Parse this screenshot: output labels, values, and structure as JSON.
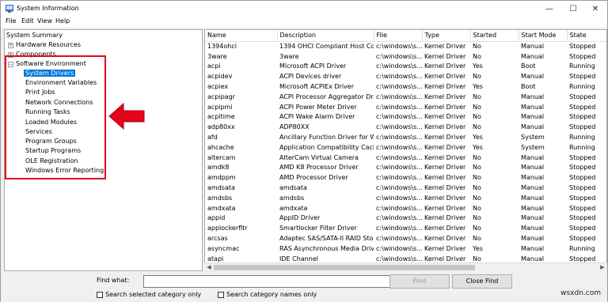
{
  "window": {
    "title": "System Information",
    "icon": "system-info-icon",
    "controls": {
      "minimize": "—",
      "maximize": "☐",
      "close": "✕"
    }
  },
  "menu": [
    "File",
    "Edit",
    "View",
    "Help"
  ],
  "tree": {
    "system_summary": "System Summary",
    "hardware_resources": "Hardware Resources",
    "components": "Components",
    "software_environment": "Software Environment",
    "children": [
      "System Drivers",
      "Environment Variables",
      "Print Jobs",
      "Network Connections",
      "Running Tasks",
      "Loaded Modules",
      "Services",
      "Program Groups",
      "Startup Programs",
      "OLE Registration",
      "Windows Error Reporting"
    ],
    "selected": "System Drivers",
    "expander_plus": "+",
    "expander_minus": "−"
  },
  "annotation": {
    "box_color": "#e3051a",
    "arrow_color": "#e3051a"
  },
  "table": {
    "columns": [
      "Name",
      "Description",
      "File",
      "Type",
      "Started",
      "Start Mode",
      "State"
    ],
    "rows": [
      [
        "1394ohci",
        "1394 OHCI Compliant Host Co...",
        "c:\\windows\\s...",
        "Kernel Driver",
        "No",
        "Manual",
        "Stopped"
      ],
      [
        "3ware",
        "3ware",
        "c:\\windows\\s...",
        "Kernel Driver",
        "No",
        "Manual",
        "Stopped"
      ],
      [
        "acpi",
        "Microsoft ACPI Driver",
        "c:\\windows\\s...",
        "Kernel Driver",
        "Yes",
        "Boot",
        "Running"
      ],
      [
        "acpidev",
        "ACPI Devices driver",
        "c:\\windows\\s...",
        "Kernel Driver",
        "No",
        "Manual",
        "Stopped"
      ],
      [
        "acpiex",
        "Microsoft ACPIEx Driver",
        "c:\\windows\\s...",
        "Kernel Driver",
        "Yes",
        "Boot",
        "Running"
      ],
      [
        "acpipagr",
        "ACPI Processor Aggregator Dr...",
        "c:\\windows\\s...",
        "Kernel Driver",
        "No",
        "Manual",
        "Stopped"
      ],
      [
        "acpipmi",
        "ACPI Power Meter Driver",
        "c:\\windows\\s...",
        "Kernel Driver",
        "No",
        "Manual",
        "Stopped"
      ],
      [
        "acpitime",
        "ACPI Wake Alarm Driver",
        "c:\\windows\\s...",
        "Kernel Driver",
        "No",
        "Manual",
        "Stopped"
      ],
      [
        "adp80xx",
        "ADP80XX",
        "c:\\windows\\s...",
        "Kernel Driver",
        "No",
        "Manual",
        "Stopped"
      ],
      [
        "afd",
        "Ancillary Function Driver for Wi...",
        "c:\\windows\\s...",
        "Kernel Driver",
        "Yes",
        "System",
        "Running"
      ],
      [
        "ahcache",
        "Application Compatibility Cache",
        "c:\\windows\\s...",
        "Kernel Driver",
        "Yes",
        "System",
        "Running"
      ],
      [
        "altercam",
        "AlterCam Virtual Camera",
        "c:\\windows\\s...",
        "Kernel Driver",
        "No",
        "Manual",
        "Stopped"
      ],
      [
        "amdk8",
        "AMD K8 Processor Driver",
        "c:\\windows\\s...",
        "Kernel Driver",
        "No",
        "Manual",
        "Stopped"
      ],
      [
        "amdppm",
        "AMD Processor Driver",
        "c:\\windows\\s...",
        "Kernel Driver",
        "No",
        "Manual",
        "Stopped"
      ],
      [
        "amdsata",
        "amdsata",
        "c:\\windows\\s...",
        "Kernel Driver",
        "No",
        "Manual",
        "Stopped"
      ],
      [
        "amdsbs",
        "amdsbs",
        "c:\\windows\\s...",
        "Kernel Driver",
        "No",
        "Manual",
        "Stopped"
      ],
      [
        "amdxata",
        "amdxata",
        "c:\\windows\\s...",
        "Kernel Driver",
        "No",
        "Manual",
        "Stopped"
      ],
      [
        "appid",
        "AppID Driver",
        "c:\\windows\\s...",
        "Kernel Driver",
        "No",
        "Manual",
        "Stopped"
      ],
      [
        "applockerfltr",
        "Smartlocker Filter Driver",
        "c:\\windows\\s...",
        "Kernel Driver",
        "No",
        "Manual",
        "Stopped"
      ],
      [
        "arcsas",
        "Adaptec SAS/SATA-II RAID Stor...",
        "c:\\windows\\s...",
        "Kernel Driver",
        "No",
        "Manual",
        "Stopped"
      ],
      [
        "asyncmac",
        "RAS Asynchronous Media Driver",
        "c:\\windows\\s...",
        "Kernel Driver",
        "Yes",
        "Manual",
        "Running"
      ],
      [
        "atapi",
        "IDE Channel",
        "c:\\windows\\s...",
        "Kernel Driver",
        "No",
        "Manual",
        "Stopped"
      ]
    ]
  },
  "find": {
    "label": "Find what:",
    "value": "",
    "find_button": "Find",
    "close_find_button": "Close Find",
    "search_selected": "Search selected category only",
    "search_names": "Search category names only"
  },
  "watermark": "wsxdn.com"
}
